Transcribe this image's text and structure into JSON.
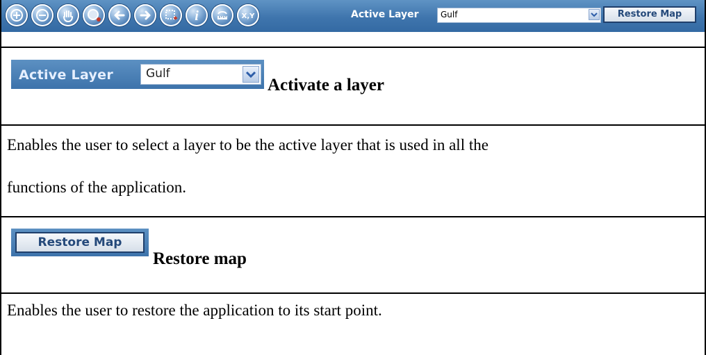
{
  "toolbar": {
    "tools": [
      {
        "icon": "zoom-in-icon",
        "label": ""
      },
      {
        "icon": "zoom-out-icon",
        "label": ""
      },
      {
        "icon": "pan-hand-icon",
        "label": ""
      },
      {
        "icon": "full-extent-icon",
        "label": ""
      },
      {
        "icon": "back-arrow-icon",
        "label": ""
      },
      {
        "icon": "forward-arrow-icon",
        "label": ""
      },
      {
        "icon": "select-box-icon",
        "label": ""
      },
      {
        "icon": "info-icon",
        "label": "i"
      },
      {
        "icon": "measure-icon",
        "label": ""
      },
      {
        "icon": "xy-coordinates-icon",
        "label": "X,Y"
      }
    ],
    "active_layer_label": "Active Layer",
    "active_layer_value": "Gulf",
    "restore_label": "Restore Map",
    "accent": "#3f75ad"
  },
  "section_active_layer": {
    "widget_label": "Active Layer",
    "widget_value": "Gulf",
    "heading": "Activate a layer",
    "description_line1": "Enables the user to select a layer to be the active layer that is used in all the",
    "description_line2": "functions of the application."
  },
  "section_restore": {
    "button_label": "Restore Map",
    "heading": "Restore map",
    "description": "Enables the user to restore the application to its start point."
  }
}
